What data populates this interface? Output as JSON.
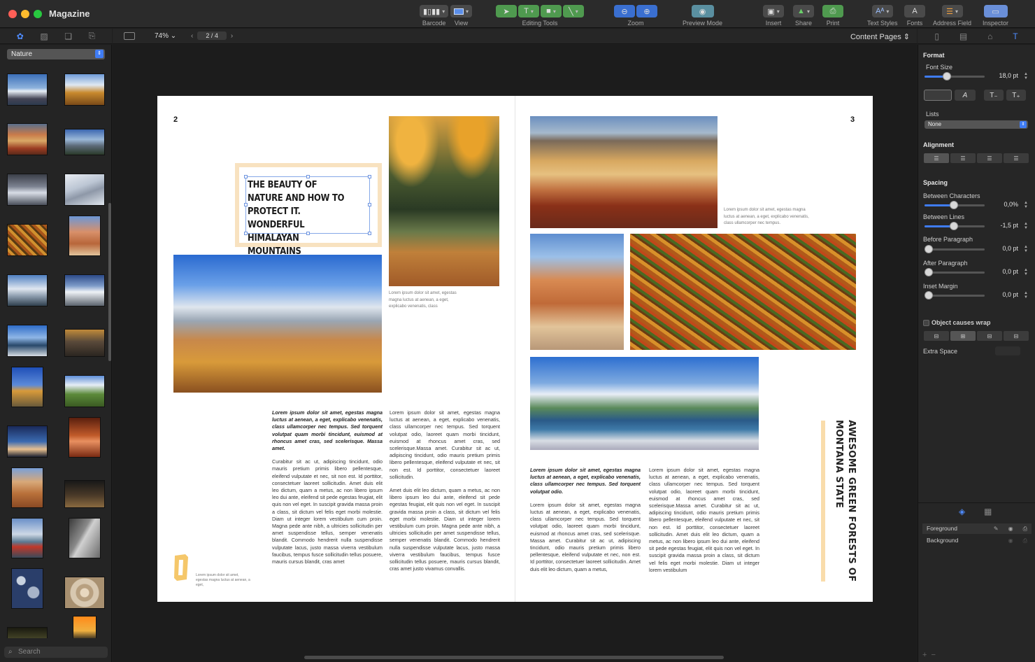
{
  "app": {
    "title": "Magazine"
  },
  "toolbar": {
    "barcode": "Barcode",
    "view": "View",
    "editing_tools": "Editing Tools",
    "zoom": "Zoom",
    "preview_mode": "Preview Mode",
    "insert": "Insert",
    "share": "Share",
    "print": "Print",
    "text_styles": "Text Styles",
    "fonts": "Fonts",
    "address_field": "Address Field",
    "inspector": "Inspector"
  },
  "library": {
    "category": "Nature",
    "search_placeholder": "Search"
  },
  "canvas": {
    "zoom_level": "74%",
    "page_indicator": "2 / 4",
    "view_mode": "Content Pages"
  },
  "document": {
    "left_page_number": "2",
    "right_page_number": "3",
    "headline": "The beauty of nature and how to protect it. Wonderful Himalayan mountains",
    "vertical_title_line1": "Awesome green forests of",
    "vertical_title_line2": "Montana State",
    "caption_forest": "Lorem ipsum dolor sit amet, egestas magna luctus at aenean, a eget, explicabo venenatis, class",
    "caption_hills": "Lorem ipsum dolor sit amet, egestas magna luctus at aenean, a eget, explicabo venenatis, class ullamcorper nec tempus.",
    "caption_quote": "Lorem ipsum dolor sit amet, egestas magna luctus at aenean, a eget,",
    "lead_text": "Lorem ipsum dolor sit amet, egestas magna luctus at aenean, a eget, explicabo venenatis, class ullamcorper nec tempus. Sed torquent volutpat quam morbi tincidunt, euismod at rhoncus amet cras, sed scelerisque. Massa amet.",
    "lead_text_short": "Lorem ipsum dolor sit amet, egestas magna luctus at aenean, a eget, explicabo venenatis, class ullamcorper nec tempus. Sed torquent volutpat odio.",
    "body_para1": "Curabitur sit ac ut, adipiscing tincidunt, odio mauris pretium primis libero pellentesque, eleifend vulputate et nec, sit non est. Id porttitor, consectetuer laoreet sollicitudin. Amet duis elit leo dictum, quam a metus, ac non libero ipsum leo dui ante, eleifend sit pede egestas feugiat, elit quis non vel eget. In suscipit gravida massa proin a class, sit dictum vel felis eget morbi molestie. Diam ut integer lorem vestibulum cum proin. Magna pede ante nibh, a ultricies sollicitudin per amet suspendisse tellus, semper venenatis blandit. Commodo hendrerit nulla suspendisse vulputate lacus, justo massa viverra vestibulum faucibus, tempus fusce sollicitudin tellus posuere, mauris cursus blandit, cras amet",
    "body_col2": "Lorem ipsum dolor sit amet, egestas magna luctus at aenean, a eget, explicabo venenatis, class ullamcorper nec tempus. Sed torquent volutpat odio, laoreet quam morbi tincidunt, euismod at rhoncus amet cras, sed scelerisque.Massa amet. Curabitur sit ac ut, adipiscing tincidunt, odio mauris pretium primis libero pellentesque, eleifend vulputate et nec, sit non est. Id porttitor, consectetuer laoreet sollicitudin.",
    "body_col2b": "Amet duis elit leo dictum, quam a metus, ac non libero ipsum leo dui ante, eleifend sit pede egestas feugiat, elit quis non vel eget. In suscipit gravida massa proin a class, sit dictum vel felis eget morbi molestie. Diam ut integer lorem vestibulum cum proin. Magna pede ante nibh, a ultricies sollicitudin per amet suspendisse tellus, semper venenatis blandit. Commodo hendrerit nulla suspendisse vulputate lacus, justo massa viverra vestibulum faucibus, tempus fusce sollicitudin tellus posuere, mauris cursus blandit, cras amet justo vivamus convallis.",
    "body_col3b": "Lorem ipsum dolor sit amet, egestas magna luctus at aenean, a eget, explicabo venenatis, class ullamcorper nec tempus. Sed torquent volutpat odio, laoreet quam morbi tincidunt, euismod at rhoncus amet cras, sed scelerisque. Massa amet. Curabitur sit ac ut, adipiscing tincidunt, odio mauris pretium primis libero pellentesque, eleifend vulputate et nec, non est. Id porttitor, consectetuer laoreet sollicitudin. Amet duis elit leo dictum, quam a metus,",
    "body_col4": "Lorem ipsum dolor sit amet, egestas magna luctus at aenean, a eget, explicabo venenatis, class ullamcorper nec tempus. Sed torquent volutpat odio, laoreet quam morbi tincidunt, euismod at rhoncus amet cras, sed scelerisque.Massa amet. Curabitur sit ac ut, adipiscing tincidunt, odio mauris pretium primis libero pellentesque, eleifend vulputate et nec, sit non est. Id porttitor, consectetuer laoreet sollicitudin. Amet duis elit leo dictum, quam a metus, ac non libero ipsum leo dui ante, eleifend sit pede egestas feugiat, elit quis non vel eget. In suscipit gravida massa proin a class, sit dictum vel felis eget morbi molestie. Diam ut integer lorem vestibulum"
  },
  "inspector": {
    "format": "Format",
    "font_size_label": "Font Size",
    "font_size": "18,0 pt",
    "lists_label": "Lists",
    "lists_value": "None",
    "alignment": "Alignment",
    "spacing": "Spacing",
    "between_characters": "Between Characters",
    "between_characters_value": "0,0%",
    "between_lines": "Between Lines",
    "between_lines_value": "-1,5 pt",
    "before_paragraph": "Before Paragraph",
    "before_paragraph_value": "0,0 pt",
    "after_paragraph": "After Paragraph",
    "after_paragraph_value": "0,0 pt",
    "inset_margin": "Inset Margin",
    "inset_margin_value": "0,0 pt",
    "object_wrap": "Object causes wrap",
    "extra_space": "Extra Space",
    "layer_foreground": "Foreground",
    "layer_background": "Background"
  },
  "colors": {
    "accent": "#3f7cf4",
    "headline_frame": "#f8e2c0",
    "vertical_bar": "#f9dcab"
  }
}
